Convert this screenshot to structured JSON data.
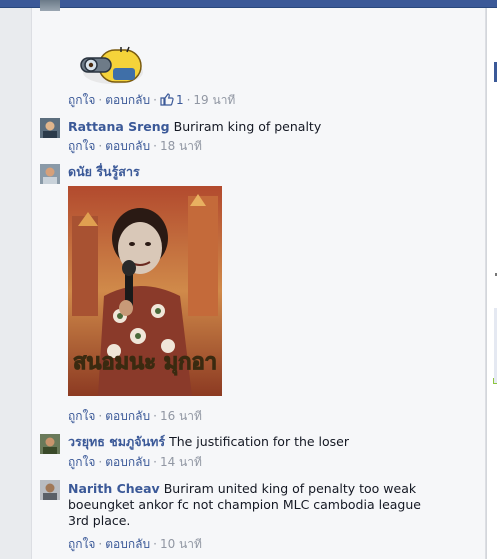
{
  "colors": {
    "topbar": "#3b5998",
    "link": "#3b5998",
    "meta": "#9197a3",
    "background": "#f6f7f9"
  },
  "actions": {
    "like_label": "ถูกใจ",
    "reply_label": "ตอบกลับ",
    "dot": "·"
  },
  "comments": [
    {
      "type": "sticker",
      "sticker_icon": "minion-sticker-icon",
      "like_count": "1",
      "time": "19 นาที"
    },
    {
      "author": "Rattana Sreng",
      "text": "Buriram king of penalty",
      "time": "18 นาที"
    },
    {
      "author": "ดนัย รื่นรู้สาร",
      "text": "",
      "photo_caption": "สนอมนะ มุกอา",
      "time": "16 นาที"
    },
    {
      "author": "วรยุทธ ชมภูจันทร์",
      "text": "The justification for the loser",
      "time": "14 นาที"
    },
    {
      "author": "Narith Cheav",
      "text_lines": [
        "Buriram united king of penalty too weak",
        "boeungket ankor fc not champion MLC cambodia league",
        "3rd place."
      ],
      "time": "10 นาที"
    }
  ]
}
